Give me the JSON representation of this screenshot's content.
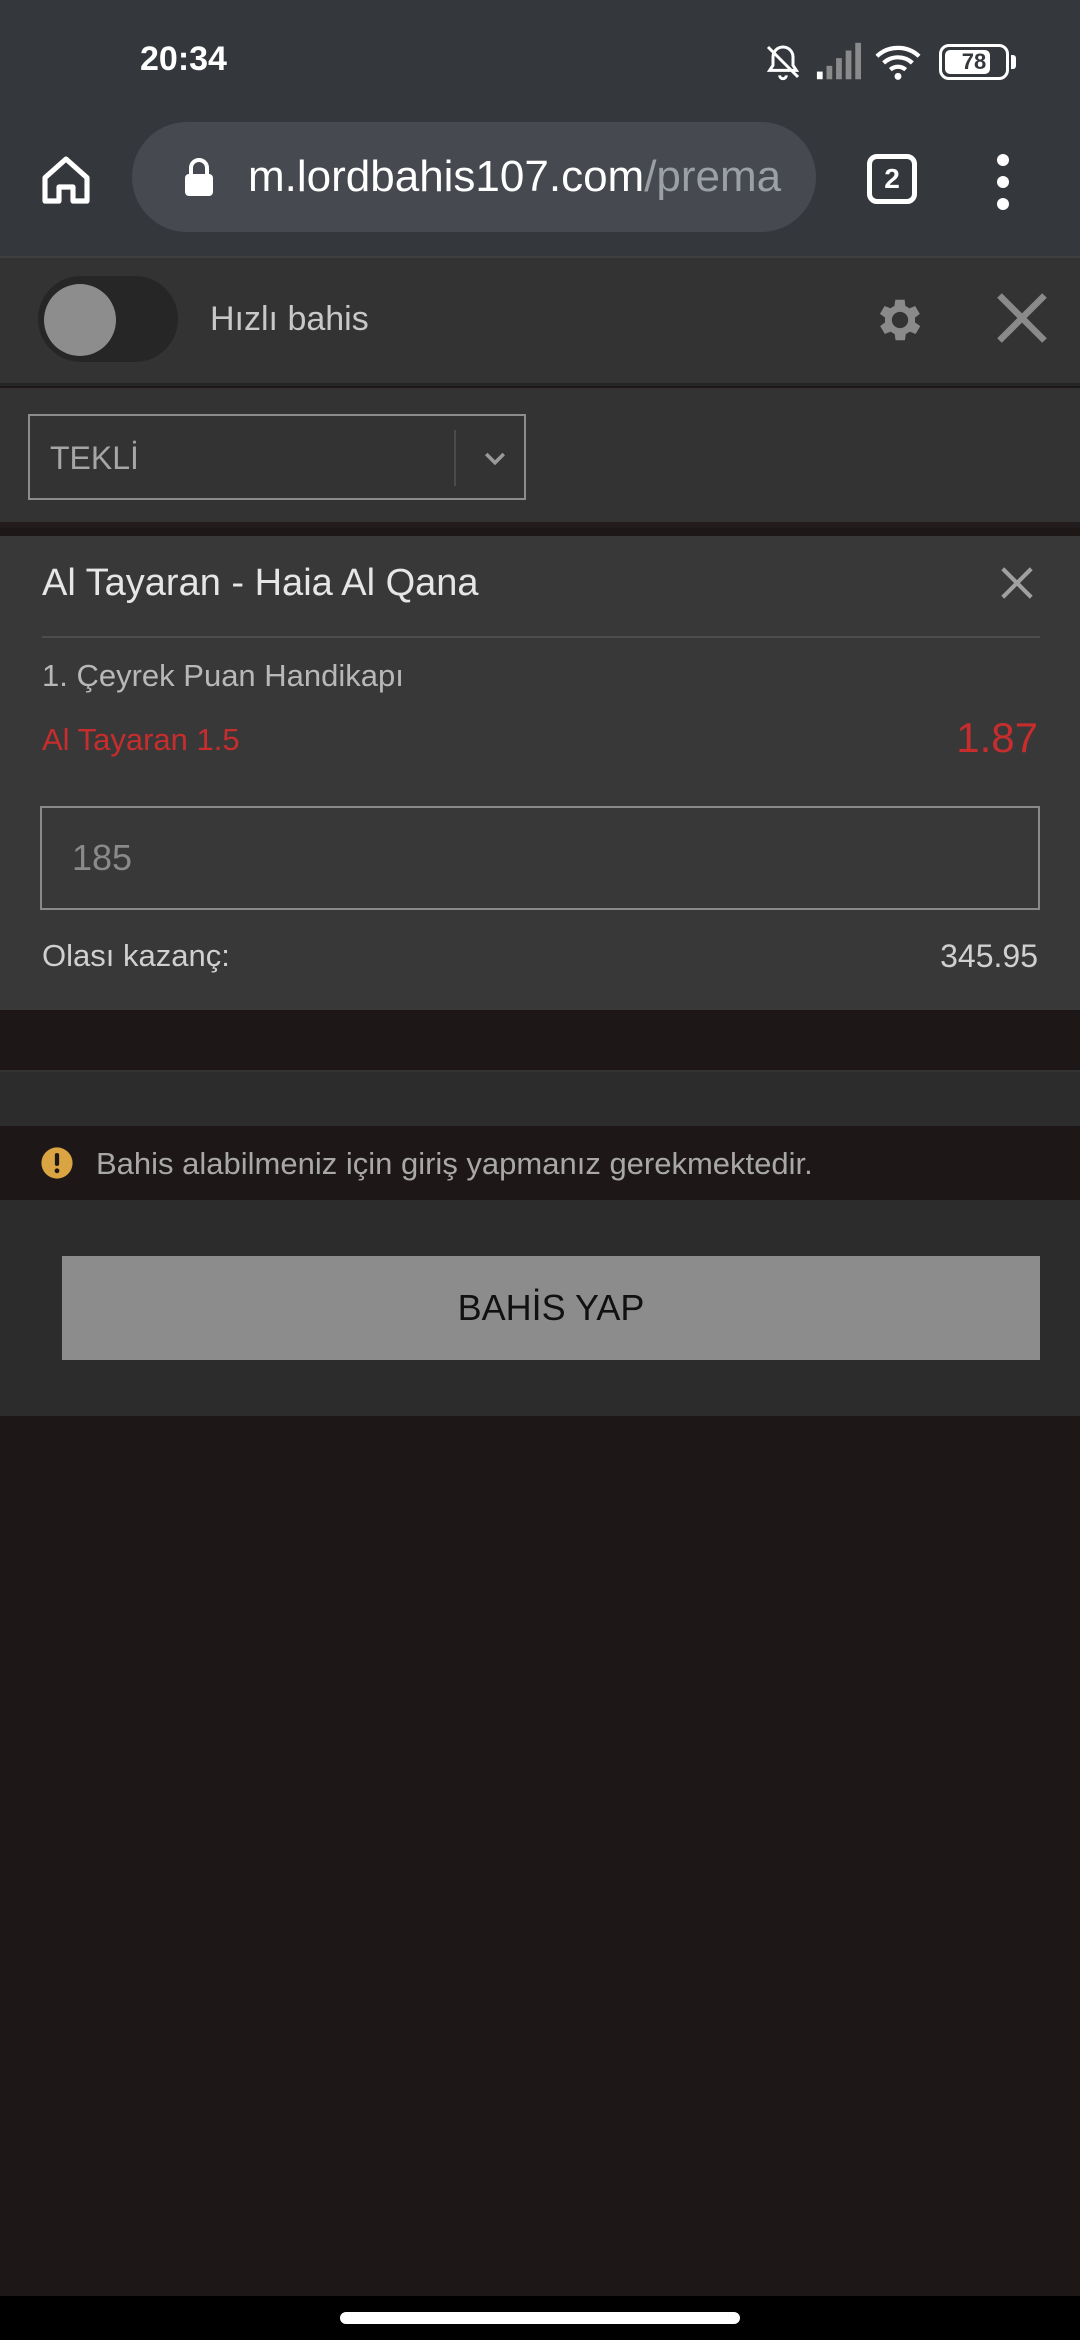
{
  "status_bar": {
    "time": "20:34",
    "battery": "78",
    "battery_level": 0.78,
    "icons": [
      "bell-muted-icon",
      "signal-icon",
      "wifi-icon",
      "battery-icon"
    ]
  },
  "browser": {
    "url_host": "m.lordbahis107.com",
    "url_path": "/prema",
    "tab_count": "2"
  },
  "slip_header": {
    "quick_bet_label": "Hızlı bahis",
    "quick_bet_enabled": false
  },
  "bet_type": {
    "selected": "TEKLİ"
  },
  "bet": {
    "event": "Al Tayaran - Haia Al Qana",
    "market": "1. Çeyrek Puan Handikapı",
    "selection": "Al Tayaran 1.5",
    "odds": "1.87",
    "stake_placeholder": "185",
    "winnings_label": "Olası kazanç:",
    "winnings_value": "345.95"
  },
  "warning": {
    "text": "Bahis alabilmeniz için giriş yapmanız gerekmektedir."
  },
  "actions": {
    "place_bet_label": "BAHİS YAP"
  },
  "colors": {
    "accent_red": "#c72d2d",
    "warning_yellow": "#d9a441",
    "background": "#1e1718"
  }
}
